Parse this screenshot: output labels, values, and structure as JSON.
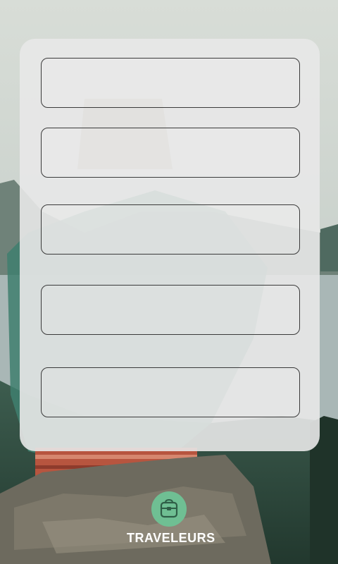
{
  "form": {
    "fields": [
      {
        "value": "",
        "placeholder": ""
      },
      {
        "value": "",
        "placeholder": ""
      },
      {
        "value": "",
        "placeholder": ""
      },
      {
        "value": "",
        "placeholder": ""
      },
      {
        "value": "",
        "placeholder": ""
      }
    ]
  },
  "brand": {
    "name": "TRAVELEURS",
    "icon": "backpack-icon",
    "accent_color": "#6fbf93"
  }
}
